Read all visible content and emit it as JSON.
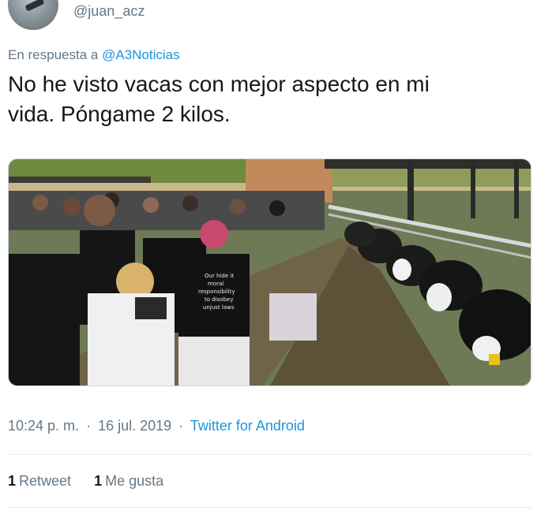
{
  "user": {
    "handle": "@juan_acz",
    "avatar_icon": "profile-avatar"
  },
  "reply": {
    "prefix": "En respuesta a",
    "mention": "@A3Noticias"
  },
  "tweet": {
    "text_line1": "No he visto vacas con mejor aspecto en mi",
    "text_line2": "vida. Póngame 2 kilos."
  },
  "media": {
    "kind": "photo",
    "shirt_text": [
      "Our hide it",
      "moral",
      "responsibility",
      "to disobey",
      "unjust laws"
    ]
  },
  "meta": {
    "time": "10:24 p. m.",
    "separator": "·",
    "date": "16 jul. 2019",
    "source": "Twitter for Android"
  },
  "stats": {
    "retweets_count": "1",
    "retweets_label": "Retweet",
    "likes_count": "1",
    "likes_label": "Me gusta"
  },
  "colors": {
    "link": "#1b95e0",
    "muted": "#657786",
    "text": "#14171a",
    "divider": "#e6ecf0"
  }
}
